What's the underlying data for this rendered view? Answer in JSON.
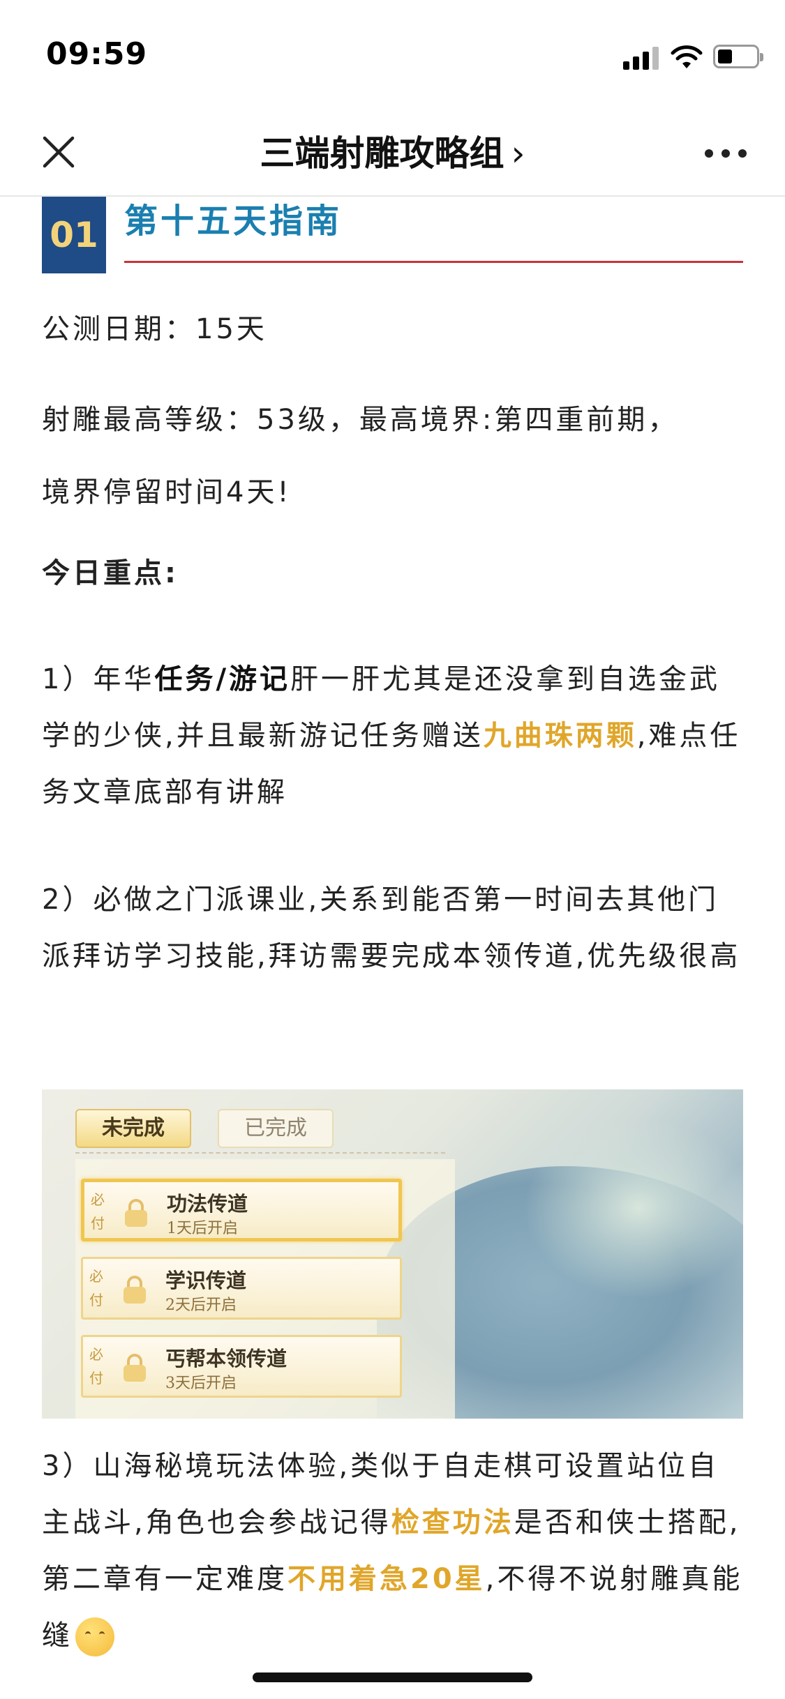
{
  "status_bar": {
    "time": "09:59"
  },
  "nav": {
    "title": "三端射雕攻略组",
    "chevron": "›",
    "icons": [
      "close-icon",
      "more-icon"
    ]
  },
  "section": {
    "number": "01",
    "title": "第十五天指南",
    "colors": {
      "number_bg": "#1f4b86",
      "number_text": "#f3d37a",
      "title": "#1a7fb0",
      "rule": "#c8323c"
    }
  },
  "article": {
    "date_line": "公测日期：15天",
    "level_line_1": "射雕最高等级：53级，最高境界:第四重前期，",
    "level_line_2": "境界停留时间4天!",
    "key_heading": "今日重点:",
    "point1": {
      "prefix": "1）年华",
      "bold": "任务/游记",
      "middle": "肝一肝尤其是还没拿到自选金武学的少侠,并且最新游记任务赠送",
      "highlight": "九曲珠两颗",
      "suffix": ",难点任务文章底部有讲解"
    },
    "point2": {
      "text": "2）必做之门派课业,关系到能否第一时间去其他门派拜访学习技能,拜访需要完成本领传道,优先级很高"
    },
    "point3": {
      "prefix": "3）山海秘境玩法体验,类似于自走棋可设置站位自主战斗,角色也会参战记得",
      "highlight1": "检查功法",
      "middle": "是否和侠士搭配,第二章有一定难度",
      "highlight2": "不用着急20星",
      "suffix": ",不得不说射雕真能缝"
    },
    "highlight_color": "#e0a62a"
  },
  "game_image": {
    "tab_active": "未完成",
    "tab_inactive": "已完成",
    "must_label": "必付",
    "tasks": [
      {
        "name": "功法传道",
        "sub": "1天后开启"
      },
      {
        "name": "学识传道",
        "sub": "2天后开启"
      },
      {
        "name": "丐帮本领传道",
        "sub": "3天后开启"
      }
    ]
  }
}
